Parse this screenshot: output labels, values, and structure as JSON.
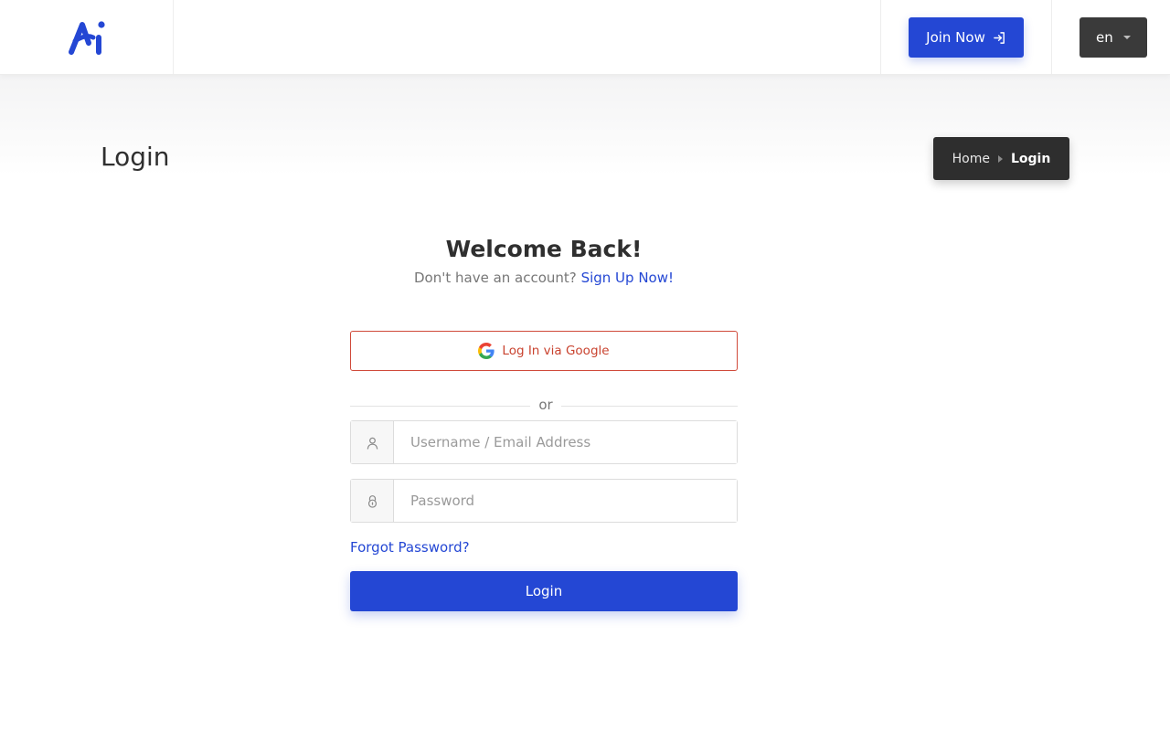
{
  "header": {
    "join_label": "Join Now",
    "language": "en"
  },
  "page": {
    "title": "Login"
  },
  "breadcrumb": {
    "home": "Home",
    "current": "Login"
  },
  "form": {
    "heading": "Welcome Back!",
    "no_account_text": "Don't have an account?",
    "signup_link": "Sign Up Now!",
    "google_label": "Log In via Google",
    "divider_text": "or",
    "username_placeholder": "Username / Email Address",
    "username_value": "",
    "password_placeholder": "Password",
    "password_value": "",
    "forgot_label": "Forgot Password?",
    "submit_label": "Login"
  },
  "icons": {
    "logo": "brand-logo",
    "join": "sign-in-arrow-icon",
    "language_caret": "caret-down-icon",
    "breadcrumb_sep": "caret-right-icon",
    "google": "google-icon",
    "username": "user-icon",
    "password": "lock-icon"
  },
  "colors": {
    "primary": "#2447d4",
    "dark": "#2e2e2e",
    "google_red": "#d04a3a",
    "muted_text": "#777777"
  }
}
